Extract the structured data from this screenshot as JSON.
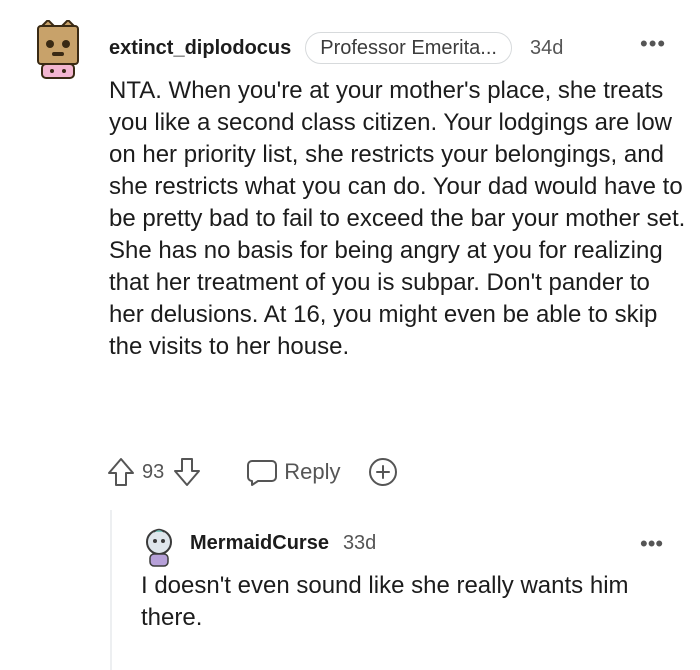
{
  "comment": {
    "username": "extinct_diplodocus",
    "flair": "Professor Emerita...",
    "age": "34d",
    "more_label": "•••",
    "body": "NTA. When you're at your mother's place, she treats you like a second class citizen. Your lodgings are low on her priority list, she restricts your belongings, and she restricts what you can do. Your dad would have to be pretty bad to fail to exceed the bar your mother set. She has no basis for being angry at you for realizing that her treatment of you is subpar. Don't pander to her delusions. At 16, you might even be able to skip the visits to her house.",
    "score": "93",
    "reply_label": "Reply",
    "icons": {
      "upvote": "arrow-up-outline-icon",
      "downvote": "arrow-down-outline-icon",
      "reply": "speech-bubble-icon",
      "award": "plus-circle-icon"
    }
  },
  "reply": {
    "username": "MermaidCurse",
    "age": "33d",
    "more_label": "•••",
    "body": "I doesn't even sound like she really wants him there."
  },
  "colors": {
    "text_primary": "#1c1c1c",
    "text_secondary": "#555555",
    "flair_border": "#d7dadc",
    "thread_line": "#edeff1"
  }
}
